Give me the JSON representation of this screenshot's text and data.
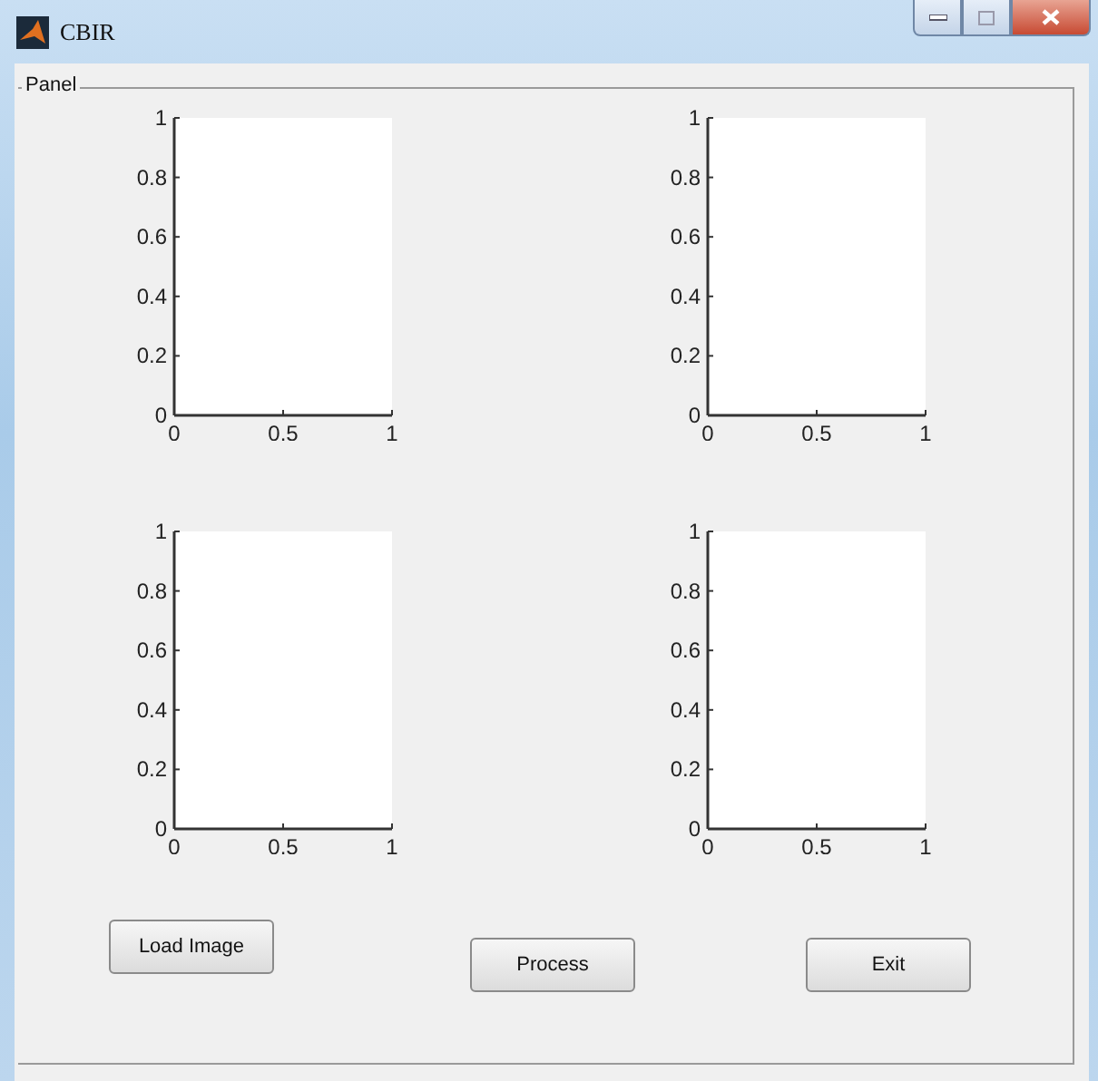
{
  "window": {
    "title": "CBIR"
  },
  "panel": {
    "title": "Panel",
    "axes": [
      {
        "chart_data": {
          "type": "line",
          "xlim": [
            0,
            1
          ],
          "ylim": [
            0,
            1
          ],
          "xticks": [
            {
              "value": 0,
              "label": "0"
            },
            {
              "value": 0.5,
              "label": "0.5"
            },
            {
              "value": 1,
              "label": "1"
            }
          ],
          "yticks": [
            {
              "value": 0,
              "label": "0"
            },
            {
              "value": 0.2,
              "label": "0.2"
            },
            {
              "value": 0.4,
              "label": "0.4"
            },
            {
              "value": 0.6,
              "label": "0.6"
            },
            {
              "value": 0.8,
              "label": "0.8"
            },
            {
              "value": 1,
              "label": "1"
            }
          ]
        }
      },
      {
        "chart_data": {
          "type": "line",
          "xlim": [
            0,
            1
          ],
          "ylim": [
            0,
            1
          ],
          "xticks": [
            {
              "value": 0,
              "label": "0"
            },
            {
              "value": 0.5,
              "label": "0.5"
            },
            {
              "value": 1,
              "label": "1"
            }
          ],
          "yticks": [
            {
              "value": 0,
              "label": "0"
            },
            {
              "value": 0.2,
              "label": "0.2"
            },
            {
              "value": 0.4,
              "label": "0.4"
            },
            {
              "value": 0.6,
              "label": "0.6"
            },
            {
              "value": 0.8,
              "label": "0.8"
            },
            {
              "value": 1,
              "label": "1"
            }
          ]
        }
      },
      {
        "chart_data": {
          "type": "line",
          "xlim": [
            0,
            1
          ],
          "ylim": [
            0,
            1
          ],
          "xticks": [
            {
              "value": 0,
              "label": "0"
            },
            {
              "value": 0.5,
              "label": "0.5"
            },
            {
              "value": 1,
              "label": "1"
            }
          ],
          "yticks": [
            {
              "value": 0,
              "label": "0"
            },
            {
              "value": 0.2,
              "label": "0.2"
            },
            {
              "value": 0.4,
              "label": "0.4"
            },
            {
              "value": 0.6,
              "label": "0.6"
            },
            {
              "value": 0.8,
              "label": "0.8"
            },
            {
              "value": 1,
              "label": "1"
            }
          ]
        }
      },
      {
        "chart_data": {
          "type": "line",
          "xlim": [
            0,
            1
          ],
          "ylim": [
            0,
            1
          ],
          "xticks": [
            {
              "value": 0,
              "label": "0"
            },
            {
              "value": 0.5,
              "label": "0.5"
            },
            {
              "value": 1,
              "label": "1"
            }
          ],
          "yticks": [
            {
              "value": 0,
              "label": "0"
            },
            {
              "value": 0.2,
              "label": "0.2"
            },
            {
              "value": 0.4,
              "label": "0.4"
            },
            {
              "value": 0.6,
              "label": "0.6"
            },
            {
              "value": 0.8,
              "label": "0.8"
            },
            {
              "value": 1,
              "label": "1"
            }
          ]
        }
      }
    ]
  },
  "buttons": [
    {
      "label": "Load Image"
    },
    {
      "label": "Process"
    },
    {
      "label": "Exit"
    }
  ]
}
